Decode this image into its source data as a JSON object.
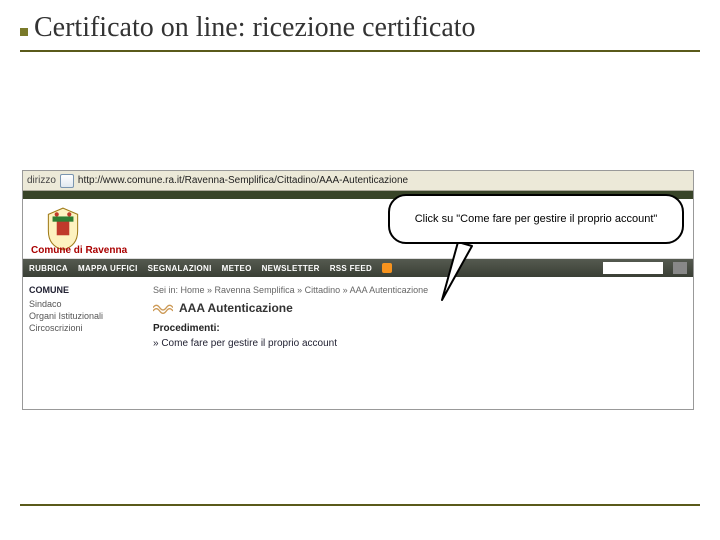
{
  "slide": {
    "title": "Certificato on line: ricezione certificato"
  },
  "browser": {
    "address_label": "dirizzo",
    "url": "http://www.comune.ra.it/Ravenna-Semplifica/Cittadino/AAA-Autenticazione"
  },
  "header": {
    "brand": "Comune di Ravenna"
  },
  "nav": {
    "items": [
      "RUBRICA",
      "MAPPA UFFICI",
      "SEGNALAZIONI",
      "METEO",
      "NEWSLETTER",
      "RSS FEED"
    ]
  },
  "sidebar": {
    "head": "COMUNE",
    "items": [
      "Sindaco",
      "Organi Istituzionali",
      "Circoscrizioni"
    ]
  },
  "main": {
    "breadcrumb": "Sei in: Home » Ravenna Semplifica » Cittadino » AAA Autenticazione",
    "title": "AAA Autenticazione",
    "proced_label": "Procedimenti:",
    "link": "» Come fare per gestire il proprio account"
  },
  "callout": {
    "text": "Click su \"Come fare per gestire il proprio account\""
  }
}
